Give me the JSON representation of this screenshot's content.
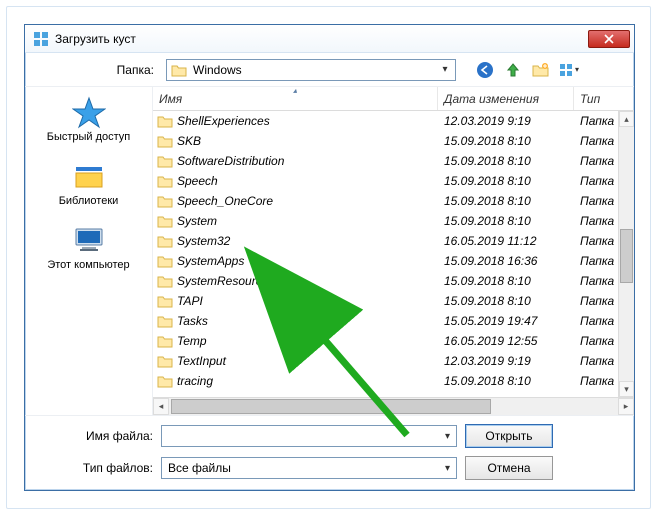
{
  "title": "Загрузить куст",
  "folder_label": "Папка:",
  "current_folder": "Windows",
  "toolbar_icons": [
    "back-icon",
    "up-icon",
    "new-folder-icon",
    "view-menu-icon"
  ],
  "places": [
    {
      "label": "Быстрый доступ",
      "icon": "quickaccess"
    },
    {
      "label": "Библиотеки",
      "icon": "libraries"
    },
    {
      "label": "Этот компьютер",
      "icon": "thispc"
    }
  ],
  "columns": {
    "name": "Имя",
    "date": "Дата изменения",
    "type": "Тип"
  },
  "rows": [
    {
      "name": "ShellExperiences",
      "date": "12.03.2019 9:19",
      "type": "Папка"
    },
    {
      "name": "SKB",
      "date": "15.09.2018 8:10",
      "type": "Папка"
    },
    {
      "name": "SoftwareDistribution",
      "date": "15.09.2018 8:10",
      "type": "Папка"
    },
    {
      "name": "Speech",
      "date": "15.09.2018 8:10",
      "type": "Папка"
    },
    {
      "name": "Speech_OneCore",
      "date": "15.09.2018 8:10",
      "type": "Папка"
    },
    {
      "name": "System",
      "date": "15.09.2018 8:10",
      "type": "Папка"
    },
    {
      "name": "System32",
      "date": "16.05.2019 11:12",
      "type": "Папка"
    },
    {
      "name": "SystemApps",
      "date": "15.09.2018 16:36",
      "type": "Папка"
    },
    {
      "name": "SystemResources",
      "date": "15.09.2018 8:10",
      "type": "Папка"
    },
    {
      "name": "TAPI",
      "date": "15.09.2018 8:10",
      "type": "Папка"
    },
    {
      "name": "Tasks",
      "date": "15.05.2019 19:47",
      "type": "Папка"
    },
    {
      "name": "Temp",
      "date": "16.05.2019 12:55",
      "type": "Папка"
    },
    {
      "name": "TextInput",
      "date": "12.03.2019 9:19",
      "type": "Папка"
    },
    {
      "name": "tracing",
      "date": "15.09.2018 8:10",
      "type": "Папка"
    }
  ],
  "filename_label": "Имя файла:",
  "filename_value": "",
  "filetype_label": "Тип файлов:",
  "filetype_value": "Все файлы",
  "open_btn": "Открыть",
  "cancel_btn": "Отмена"
}
